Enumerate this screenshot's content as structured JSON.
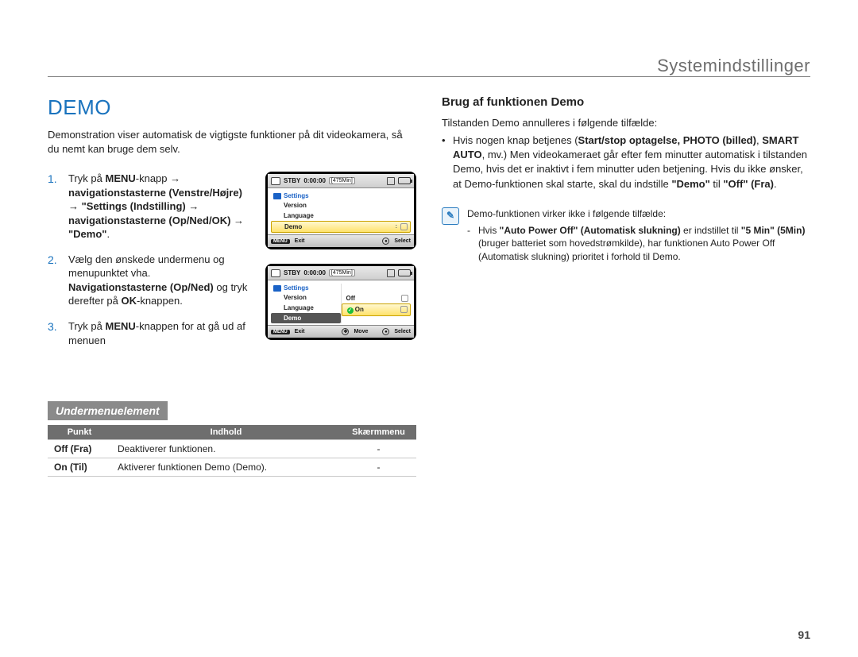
{
  "header": {
    "section_title": "Systemindstillinger"
  },
  "left": {
    "title": "DEMO",
    "intro": "Demonstration viser automatisk de vigtigste funktioner på dit videokamera, så du nemt kan bruge dem selv.",
    "steps": {
      "s1_num": "1.",
      "s1_a": "Tryk på ",
      "s1_menu": "MENU",
      "s1_b": "-knapp ",
      "s1_nav1": "navigationstasterne (Venstre/Højre)",
      "s1_arrow": "→",
      "s1_settings": " \"Settings (Indstilling) ",
      "s1_nav2": "navigationstasterne (Op/Ned/OK)",
      "s1_demo": " \"Demo\"",
      "s1_dot": ".",
      "s2_num": "2.",
      "s2_a": "Vælg den ønskede undermenu og menupunktet vha. ",
      "s2_nav": "Navigationstasterne (Op/Ned)",
      "s2_b": " og tryk derefter på ",
      "s2_ok": "OK",
      "s2_c": "-knappen.",
      "s3_num": "3.",
      "s3_a": "Tryk på ",
      "s3_menu": "MENU",
      "s3_b": "-knappen for at gå ud af menuen"
    },
    "screens": {
      "stby": "STBY",
      "time": "0:00:00",
      "remain": "[475Min]",
      "settings_label": "Settings",
      "version": "Version",
      "language": "Language",
      "demo": "Demo",
      "off": "Off",
      "on": "On",
      "menu_tag": "MENU",
      "exit": "Exit",
      "move": "Move",
      "select": "Select"
    },
    "sub_heading": "Undermenuelement",
    "table": {
      "h1": "Punkt",
      "h2": "Indhold",
      "h3": "Skærmmenu",
      "r1c1": "Off (Fra)",
      "r1c2": "Deaktiverer funktionen.",
      "r1c3": "-",
      "r2c1": "On (Til)",
      "r2c2": "Aktiverer funktionen Demo (Demo).",
      "r2c3": "-"
    }
  },
  "right": {
    "heading": "Brug af funktionen Demo",
    "lead": "Tilstanden Demo annulleres i følgende tilfælde:",
    "bullet_a": "Hvis nogen knap betjenes (",
    "bullet_b": "Start/stop optagelse, PHOTO (billed)",
    "bullet_c": ", ",
    "bullet_d": "SMART AUTO",
    "bullet_e": ", mv.) Men videokameraet går efter fem minutter automatisk i tilstanden Demo, hvis det er inaktivt i fem minutter uden betjening. Hvis du ikke ønsker, at Demo-funktionen skal starte, skal du indstille ",
    "bullet_f": "\"Demo\"",
    "bullet_g": " til ",
    "bullet_h": "\"Off\" (Fra)",
    "bullet_i": ".",
    "note_lead": "Demo-funktionen virker ikke i følgende tilfælde:",
    "note_dash_a": "Hvis ",
    "note_dash_b": "\"Auto Power Off\" (Automatisk slukning)",
    "note_dash_c": " er indstillet til ",
    "note_dash_d": "\"5 Min\" (5Min)",
    "note_dash_e": " (bruger batteriet som hovedstrømkilde), har funktionen Auto Power Off (Automatisk slukning) prioritet i forhold til Demo."
  },
  "page_number": "91"
}
